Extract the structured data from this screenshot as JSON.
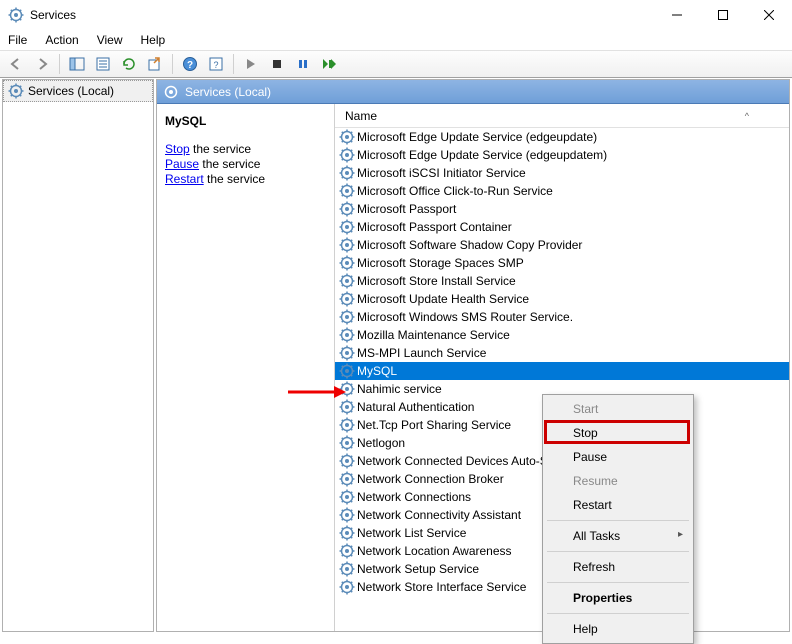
{
  "window": {
    "title": "Services"
  },
  "menubar": [
    "File",
    "Action",
    "View",
    "Help"
  ],
  "tree": {
    "root": "Services (Local)"
  },
  "content": {
    "header": "Services (Local)"
  },
  "detail": {
    "selected_service": "MySQL",
    "actions": [
      {
        "link": "Stop",
        "rest": " the service"
      },
      {
        "link": "Pause",
        "rest": " the service"
      },
      {
        "link": "Restart",
        "rest": " the service"
      }
    ]
  },
  "list": {
    "column": "Name",
    "services": [
      "Microsoft Edge Update Service (edgeupdate)",
      "Microsoft Edge Update Service (edgeupdatem)",
      "Microsoft iSCSI Initiator Service",
      "Microsoft Office Click-to-Run Service",
      "Microsoft Passport",
      "Microsoft Passport Container",
      "Microsoft Software Shadow Copy Provider",
      "Microsoft Storage Spaces SMP",
      "Microsoft Store Install Service",
      "Microsoft Update Health Service",
      "Microsoft Windows SMS Router Service.",
      "Mozilla Maintenance Service",
      "MS-MPI Launch Service",
      "MySQL",
      "Nahimic service",
      "Natural Authentication",
      "Net.Tcp Port Sharing Service",
      "Netlogon",
      "Network Connected Devices Auto-Setup",
      "Network Connection Broker",
      "Network Connections",
      "Network Connectivity Assistant",
      "Network List Service",
      "Network Location Awareness",
      "Network Setup Service",
      "Network Store Interface Service"
    ],
    "selected_index": 13
  },
  "context_menu": {
    "items": [
      {
        "label": "Start",
        "disabled": true
      },
      {
        "label": "Stop",
        "highlight": true
      },
      {
        "label": "Pause"
      },
      {
        "label": "Resume",
        "disabled": true
      },
      {
        "label": "Restart"
      },
      {
        "sep": true
      },
      {
        "label": "All Tasks",
        "submenu": true
      },
      {
        "sep": true
      },
      {
        "label": "Refresh"
      },
      {
        "sep": true
      },
      {
        "label": "Properties",
        "bold": true
      },
      {
        "sep": true
      },
      {
        "label": "Help"
      }
    ]
  }
}
